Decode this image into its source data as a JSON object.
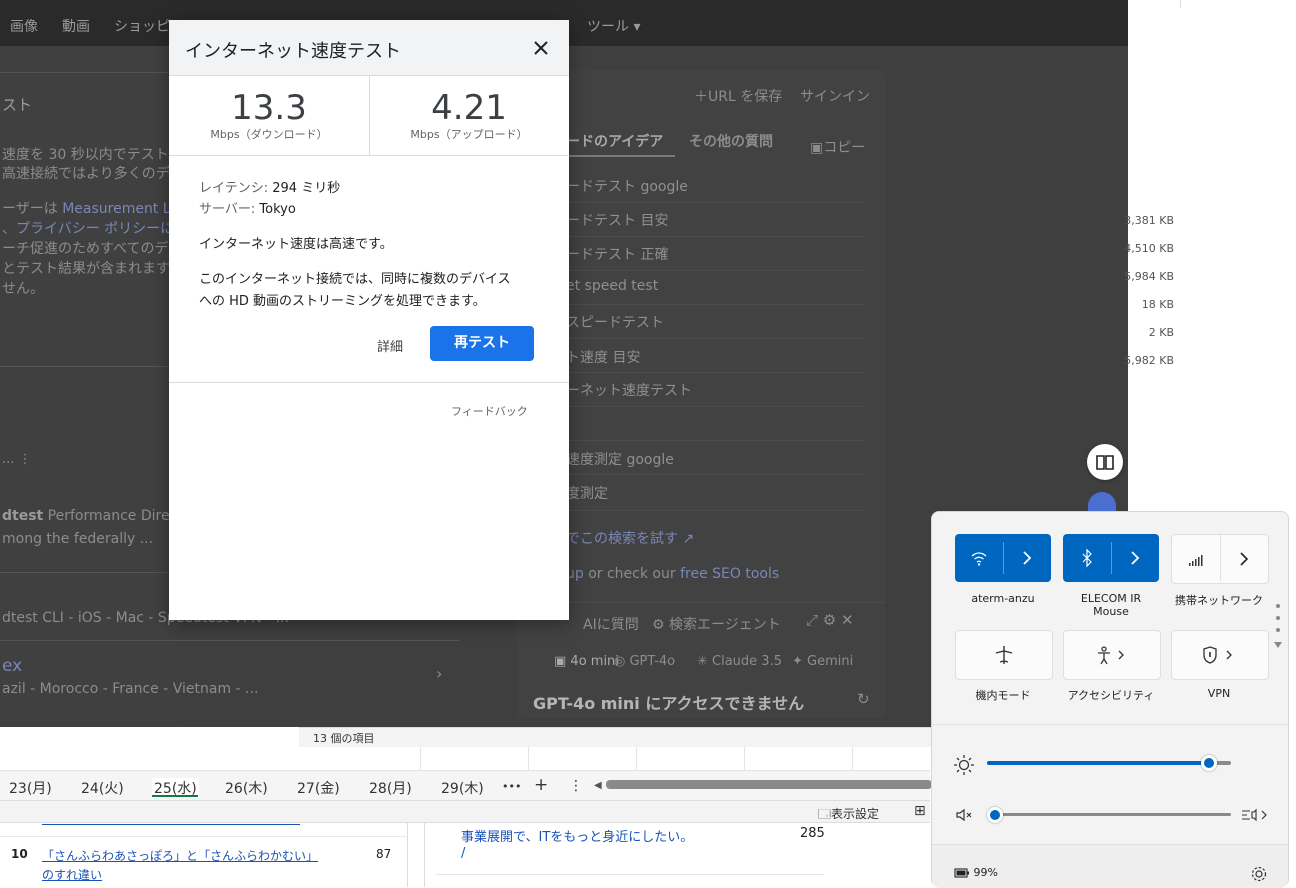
{
  "browser_nav": {
    "images": "画像",
    "videos": "動画",
    "shopping": "ショッピ",
    "tools": "ツール"
  },
  "left": {
    "heading": "スト",
    "p1": "速度を 30 秒以内でテストし",
    "p2": "高速接続ではより多くのデ",
    "p3a": "ーザーは",
    "p3link": "Measurement Lab",
    "p4link": "、プライバシー ポリシーに",
    "p5": "ーチ促進のためすべてのデ",
    "p6": "とテスト結果が含まれますか",
    "p7": "せん。",
    "dots": "... ⋮",
    "r1bold": "dtest",
    "r1rest": " Performance Director",
    "r2": "mong the federally ...",
    "r3": "dtest CLI - iOS - Mac - Speedtest VPN - ...",
    "r4": "ex",
    "r5": "azil - Morocco - France - Vietnam - ..."
  },
  "right_panel": {
    "save_url": "URL を保存",
    "sign_in": "サインイン",
    "tab1": "ードのアイデア",
    "tab2": "その他の質問",
    "copy": "コピー",
    "suggestions": [
      "ードテスト google",
      "ードテスト 目安",
      "ードテスト 正確",
      "et speed test",
      "スピードテスト",
      "ト速度 目安",
      "ーネット速度テスト",
      "",
      "速度測定 google",
      "度測定"
    ],
    "try_search": "でこの検索を試す",
    "seo_prefix": "up",
    "seo_mid": " or check our ",
    "seo_link": "free SEO tools",
    "ai_ask": "AIに質問",
    "agent": "検索エージェント",
    "models": [
      "4o mini",
      "GPT-4o",
      "Claude 3.5",
      "Gemini"
    ],
    "access_msg": "GPT-4o mini にアクセスできません"
  },
  "dialog": {
    "title": "インターネット速度テスト",
    "download_value": "13.3",
    "download_unit": "Mbps（ダウンロード）",
    "upload_value": "4.21",
    "upload_unit": "Mbps（アップロード）",
    "latency_label": "レイテンシ:",
    "latency_value": "294 ミリ秒",
    "server_label": "サーバー:",
    "server_value": "Tokyo",
    "result": "インターネット速度は高速です。",
    "desc1": "このインターネット接続では、同時に複数のデバイス",
    "desc2": "への HD 動画のストリーミングを処理できます。",
    "details": "詳細",
    "retest": "再テスト",
    "feedback": "フィードバック"
  },
  "files": {
    "sizes": [
      "3,381 KB",
      "4,510 KB",
      "5,984 KB",
      "18 KB",
      "2 KB",
      "5,982 KB"
    ],
    "status": "13 個の項目"
  },
  "sheet": {
    "tabs": [
      "23(月)",
      "24(火)",
      "25(水)",
      "26(木)",
      "27(金)",
      "28(月)",
      "29(木)"
    ],
    "more": "•••",
    "add": "+",
    "menu": "⋮",
    "display_settings": "表示設定",
    "row_num": "10",
    "row_text1": "「さんふらわあさっぽろ」と「さんふらわかむい」",
    "row_text2": "のすれ違い",
    "row_val": "87",
    "right_text": "事業展開で、ITをもっと身近にしたい。",
    "right_val": "285",
    "slash": "/"
  },
  "quick_settings": {
    "wifi_label": "aterm-anzu",
    "bt_label1": "ELECOM IR",
    "bt_label2": "Mouse",
    "cell_label": "携帯ネットワーク",
    "airplane_label": "機内モード",
    "access_label": "アクセシビリティ",
    "vpn_label": "VPN",
    "brightness": 0.91,
    "volume": 0.0,
    "battery": "99%",
    "accent": "#0067c0"
  }
}
